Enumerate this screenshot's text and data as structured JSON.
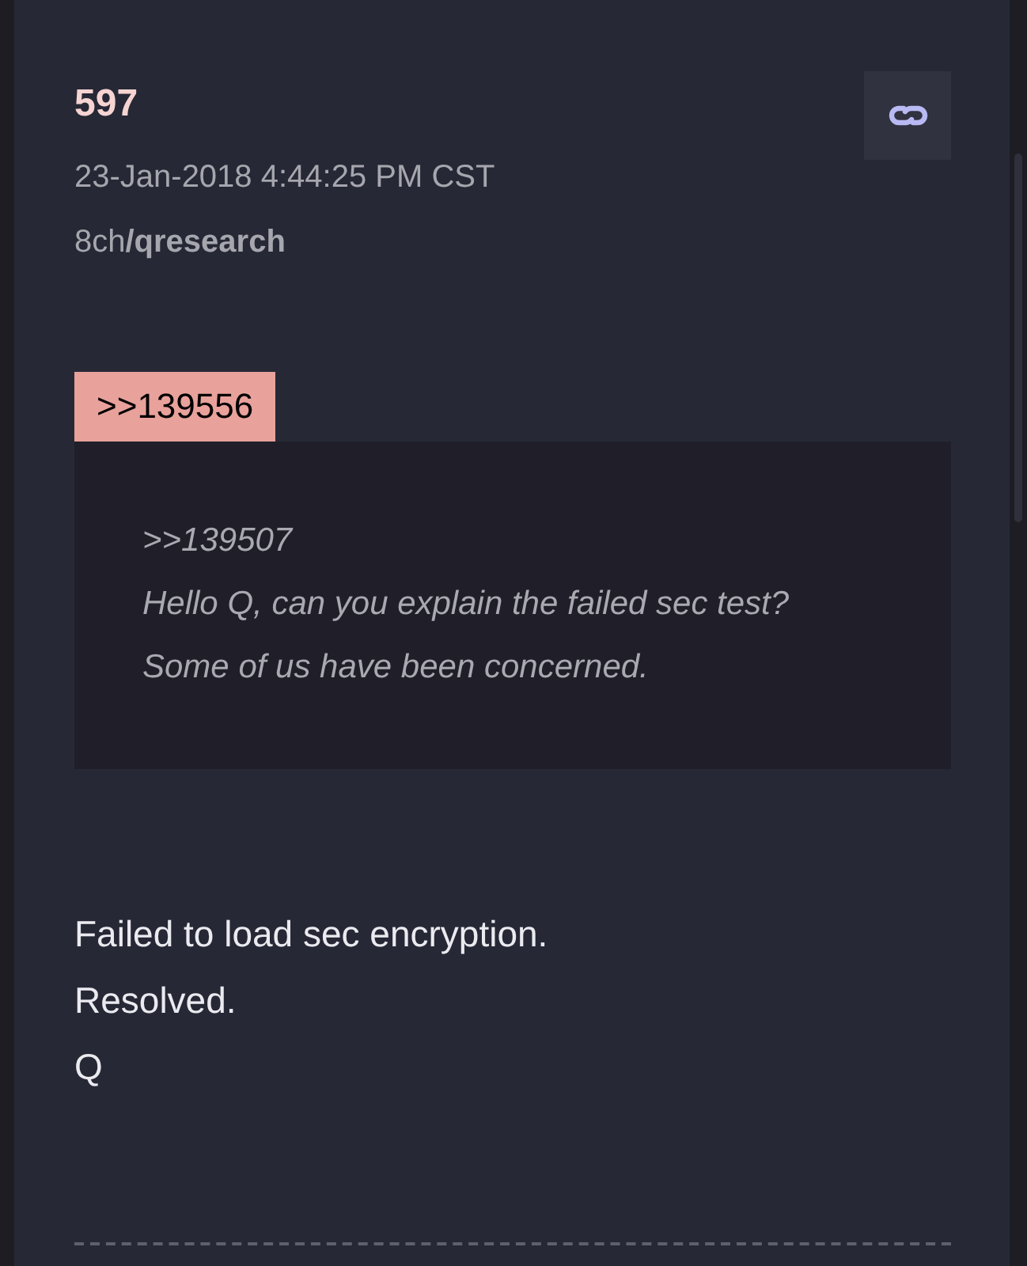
{
  "post": {
    "number": "597",
    "timestamp": "23-Jan-2018 4:44:25 PM CST",
    "source": "8ch**/qresearch**"
  },
  "reply_link": ">>139556",
  "quote": {
    "lines": [
      ">>139507",
      "Hello Q, can you explain the failed sec test?",
      "Some of us have been concerned."
    ]
  },
  "body": {
    "lines": [
      "Failed to load sec encryption.",
      "Resolved.",
      "Q"
    ]
  }
}
